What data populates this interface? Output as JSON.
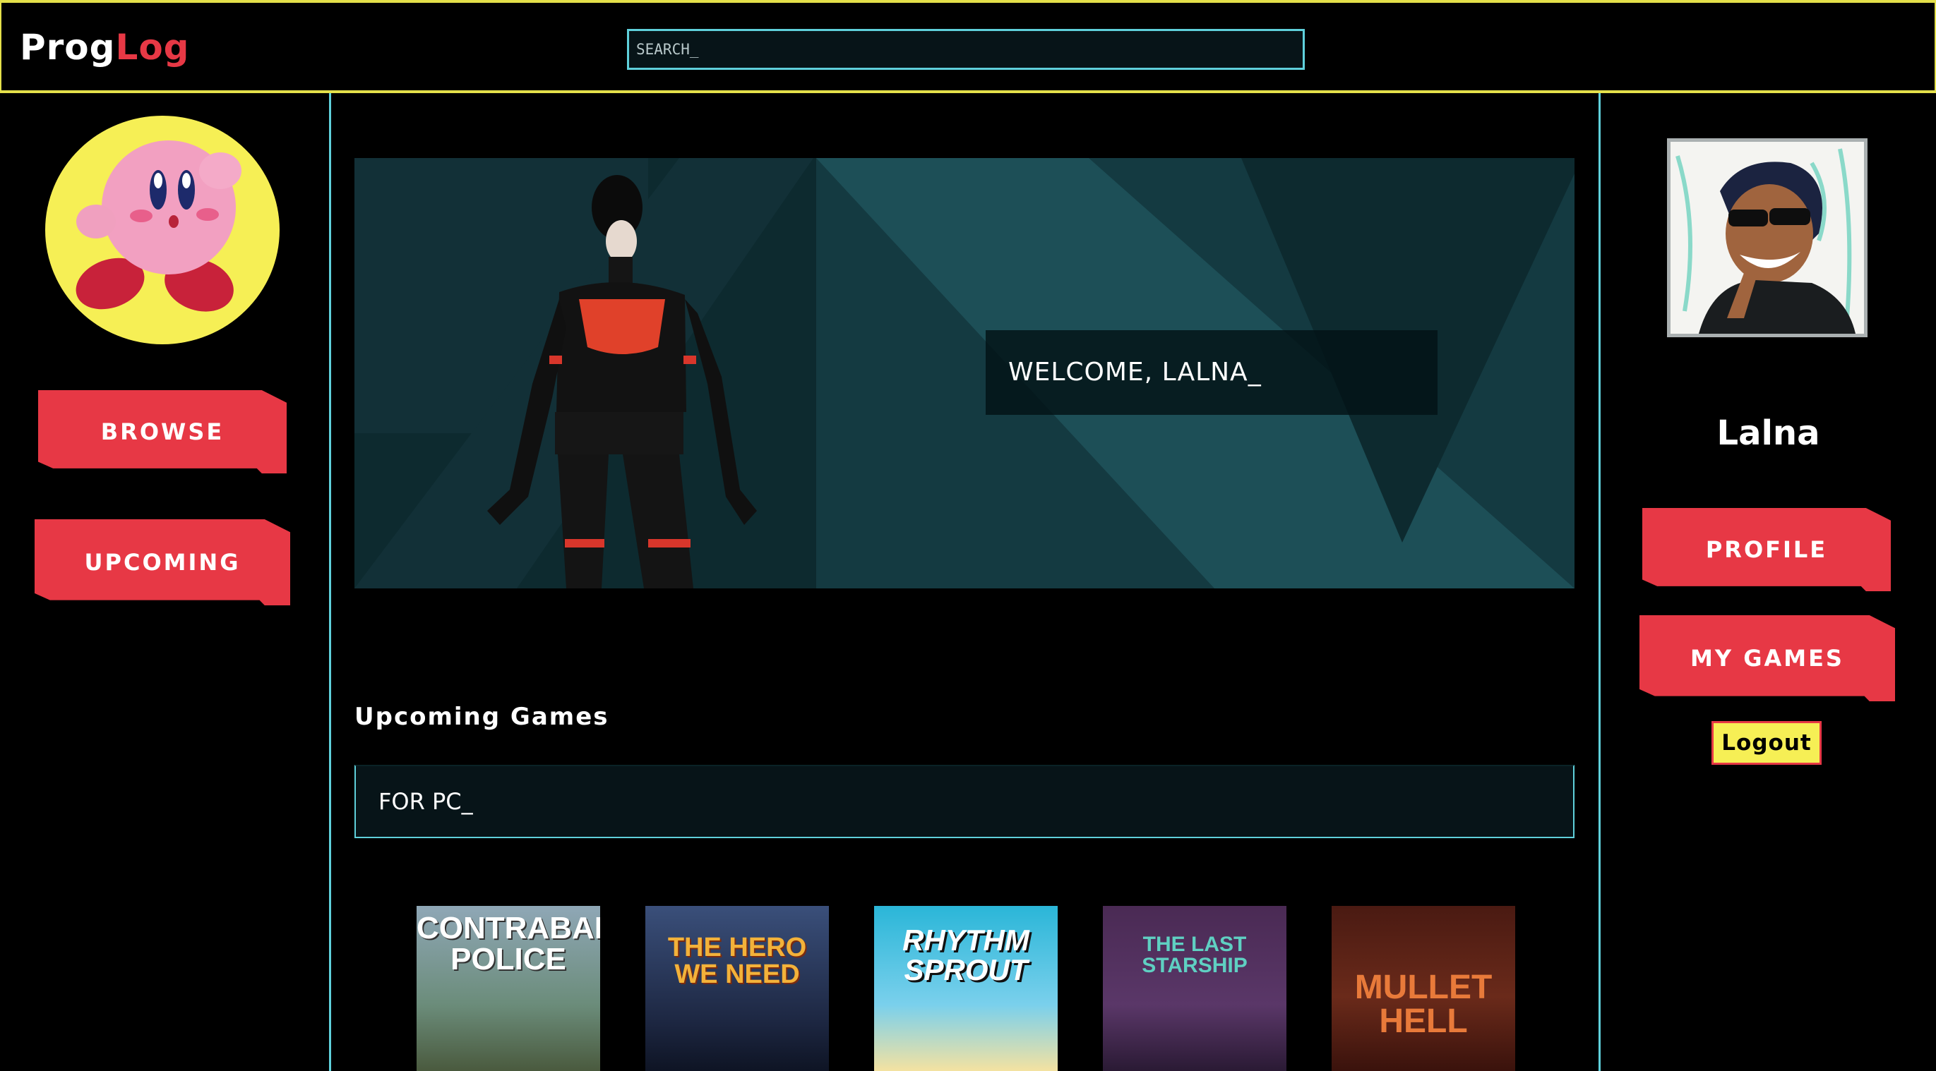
{
  "app": {
    "logo_part1": "Prog",
    "logo_part2": "Log"
  },
  "search": {
    "placeholder": "SEARCH_"
  },
  "left_nav": {
    "browse": "BROWSE",
    "upcoming": "UPCOMING"
  },
  "hero": {
    "welcome": "WELCOME, LALNA_"
  },
  "upcoming": {
    "title": "Upcoming Games",
    "platform": "FOR PC_",
    "games": [
      {
        "title": "CONTRABAND POLICE"
      },
      {
        "title": "THE HERO WE NEED"
      },
      {
        "title": "RHYTHM SPROUT"
      },
      {
        "title": "THE LAST STARSHIP"
      },
      {
        "title": "MULLET HELL"
      }
    ]
  },
  "user": {
    "name": "Lalna"
  },
  "right_nav": {
    "profile": "PROFILE",
    "my_games": "MY GAMES",
    "logout": "Logout"
  },
  "colors": {
    "accent_red": "#e73845",
    "accent_yellow": "#f6ef55",
    "accent_cyan": "#5fd0db"
  }
}
